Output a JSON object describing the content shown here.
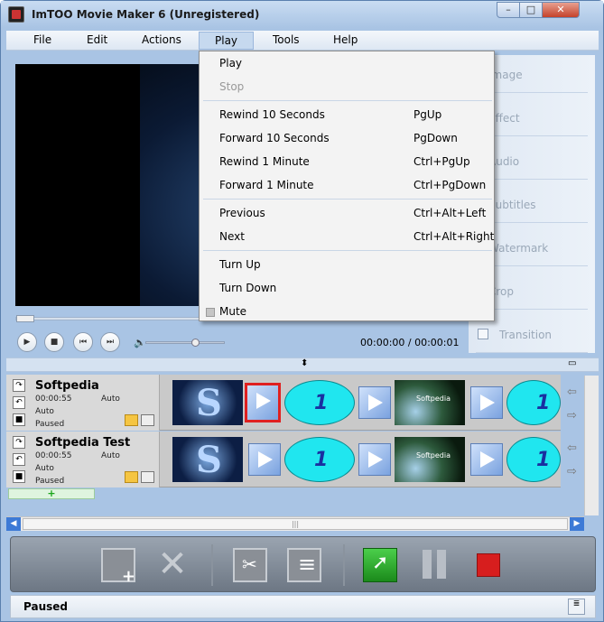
{
  "window": {
    "title": "ImTOO Movie Maker 6 (Unregistered)",
    "controls": {
      "minimize": "–",
      "maximize": "□",
      "close": "✕"
    }
  },
  "menubar": {
    "items": [
      {
        "label": "File"
      },
      {
        "label": "Edit"
      },
      {
        "label": "Actions"
      },
      {
        "label": "Play"
      },
      {
        "label": "Tools"
      },
      {
        "label": "Help"
      }
    ]
  },
  "play_menu": {
    "items": [
      {
        "label": "Play",
        "shortcut": ""
      },
      {
        "label": "Stop",
        "shortcut": "",
        "disabled": true
      },
      {
        "label": "Rewind 10 Seconds",
        "shortcut": "PgUp"
      },
      {
        "label": "Forward 10 Seconds",
        "shortcut": "PgDown"
      },
      {
        "label": "Rewind 1 Minute",
        "shortcut": "Ctrl+PgUp"
      },
      {
        "label": "Forward 1 Minute",
        "shortcut": "Ctrl+PgDown"
      },
      {
        "label": "Previous",
        "shortcut": "Ctrl+Alt+Left"
      },
      {
        "label": "Next",
        "shortcut": "Ctrl+Alt+Right"
      },
      {
        "label": "Turn Up",
        "shortcut": ""
      },
      {
        "label": "Turn Down",
        "shortcut": ""
      },
      {
        "label": "Mute",
        "shortcut": "",
        "checked": false
      }
    ]
  },
  "player": {
    "time": "00:00:00 / 00:00:01",
    "seek_position": 0,
    "volume_level": 0.65
  },
  "side_panel": {
    "items": [
      {
        "label": "Image"
      },
      {
        "label": "Effect"
      },
      {
        "label": "Audio"
      },
      {
        "label": "Subtitles"
      },
      {
        "label": "Watermark"
      },
      {
        "label": "Crop"
      },
      {
        "label": "Transition",
        "checked": false
      }
    ]
  },
  "tracks": [
    {
      "name": "Softpedia",
      "duration": "00:00:55",
      "mode1": "Auto",
      "mode2": "Auto",
      "status": "Paused"
    },
    {
      "name": "Softpedia Test",
      "duration": "00:00:55",
      "mode1": "Auto",
      "mode2": "Auto",
      "status": "Paused"
    }
  ],
  "clip_labels": {
    "s_letter": "S",
    "clock_hand": "1",
    "earth_text": "Softpedia"
  },
  "add_track": {
    "label": "+"
  },
  "status": {
    "text": "Paused"
  },
  "colors": {
    "accent": "#3d7ad6",
    "start": "#1b8a1b",
    "stop": "#d71e1e",
    "selected_transition": "#e02020"
  },
  "icons": {
    "toolbar": [
      "add-clip-icon",
      "delete-icon",
      "cut-icon",
      "edit-icon",
      "start-convert-icon",
      "pause-icon",
      "stop-icon"
    ]
  }
}
